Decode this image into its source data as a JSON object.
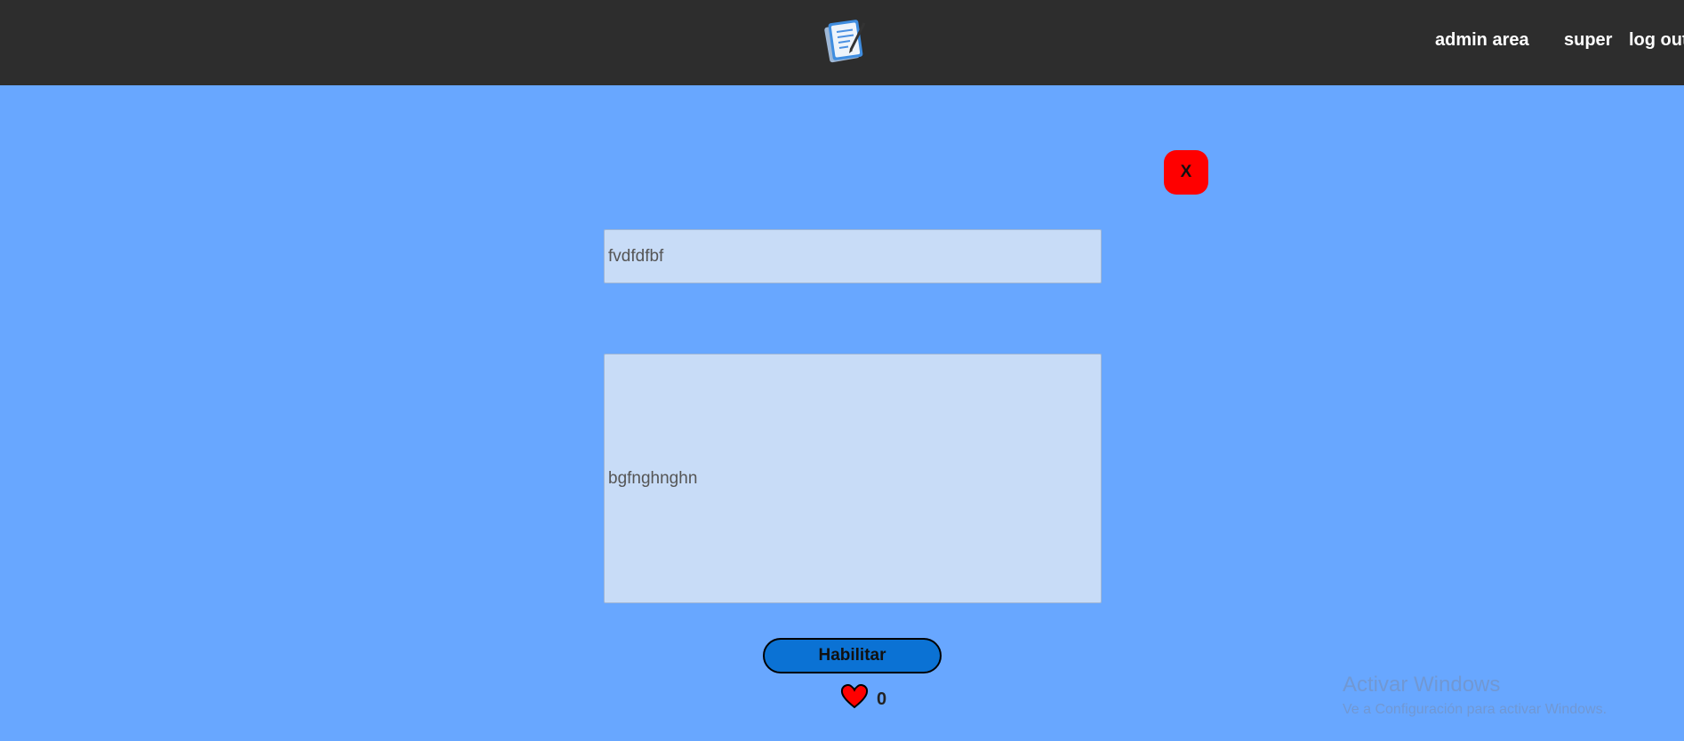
{
  "header": {
    "logo_icon": "notepad-icon",
    "nav": {
      "admin_label": "admin area",
      "user_label": "super",
      "logout_label": "log out"
    }
  },
  "editor": {
    "close_label": "X",
    "title_value": "fvdfdfbf",
    "body_value": "bgfnghnghn",
    "enable_label": "Habilitar",
    "like_icon": "heart-icon",
    "like_count": "0"
  },
  "watermark": {
    "title": "Activar Windows",
    "subtitle": "Ve a Configuración para activar Windows."
  },
  "colors": {
    "background": "#68a7ff",
    "navbar": "#2d2d2d",
    "close_button": "#ff0000",
    "enable_button": "#0b72d4",
    "field_background": "#c8dcf7",
    "heart": "#ff0000"
  }
}
